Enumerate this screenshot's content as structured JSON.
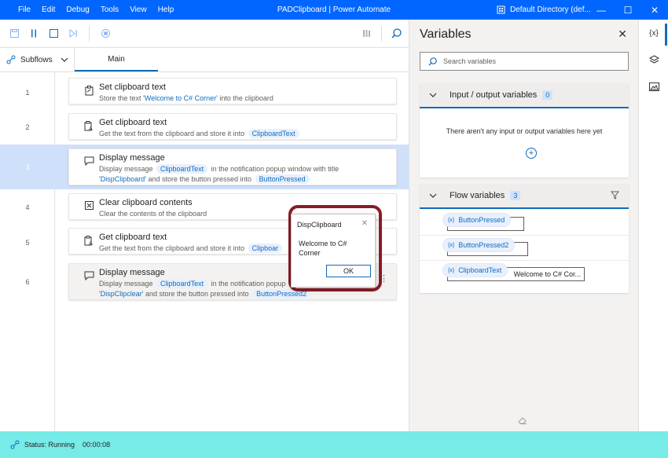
{
  "titlebar": {
    "menu": [
      "File",
      "Edit",
      "Debug",
      "Tools",
      "View",
      "Help"
    ],
    "title": "PADClipboard | Power Automate",
    "directory": "Default Directory (def...",
    "minimize": "—",
    "maximize": "☐",
    "close": "✕"
  },
  "toolbar": {
    "icons": [
      "save-icon",
      "pause-icon",
      "stop-icon",
      "next-step-icon",
      "record-icon",
      "ui-elements-icon",
      "search-icon"
    ]
  },
  "tabs": {
    "subflows": "Subflows",
    "main": "Main"
  },
  "actions": [
    {
      "num": "1",
      "title": "Set clipboard text",
      "desc_a": "Store the text ",
      "lit": "'Welcome to C# Corner'",
      "desc_b": " into the clipboard"
    },
    {
      "num": "2",
      "title": "Get clipboard text",
      "desc_a": "Get the text from the clipboard and store it into",
      "var1": "ClipboardText"
    },
    {
      "num": "3",
      "title": "Display message",
      "desc_a": "Display message",
      "var1": "ClipboardText",
      "desc_b": "in the notification popup window with title",
      "lit": "'DispClipboard'",
      "desc_c": " and store the button pressed into",
      "var2": "ButtonPressed"
    },
    {
      "num": "4",
      "title": "Clear clipboard contents",
      "desc_a": "Clear the contents of the clipboard"
    },
    {
      "num": "5",
      "title": "Get clipboard text",
      "desc_a": "Get the text from the clipboard and store it into",
      "var1": "Clipboar"
    },
    {
      "num": "6",
      "title": "Display message",
      "desc_a": "Display message",
      "var1": "ClipboardText",
      "desc_b": "in the notification popup",
      "lit": "'DispClipclear'",
      "desc_c": " and store the button pressed into",
      "var2": "ButtonPressed2"
    }
  ],
  "dialog": {
    "title": "DispClipboard",
    "close": "✕",
    "message": "Welcome to C# Corner",
    "ok": "OK"
  },
  "variables": {
    "title": "Variables",
    "close": "✕",
    "search_placeholder": "Search variables",
    "io_section": {
      "label": "Input / output variables",
      "count": "0",
      "empty": "There aren't any input or output variables here yet"
    },
    "flow_section": {
      "label": "Flow variables",
      "count": "3"
    },
    "flow_vars": [
      {
        "name": "ButtonPressed",
        "value": ""
      },
      {
        "name": "ButtonPressed2",
        "value": ""
      },
      {
        "name": "ClipboardText",
        "value": "Welcome to C# Cor..."
      }
    ]
  },
  "rail": {
    "variables_label": "{x}"
  },
  "status": {
    "text": "Status: Running",
    "time": "00:00:08"
  },
  "colors": {
    "titlebar": "#0066ff",
    "accent": "#0f6cbd",
    "status_bg": "#76ebe7",
    "selected_row": "#cfe0fb",
    "highlight_border": "#8a1c28"
  }
}
